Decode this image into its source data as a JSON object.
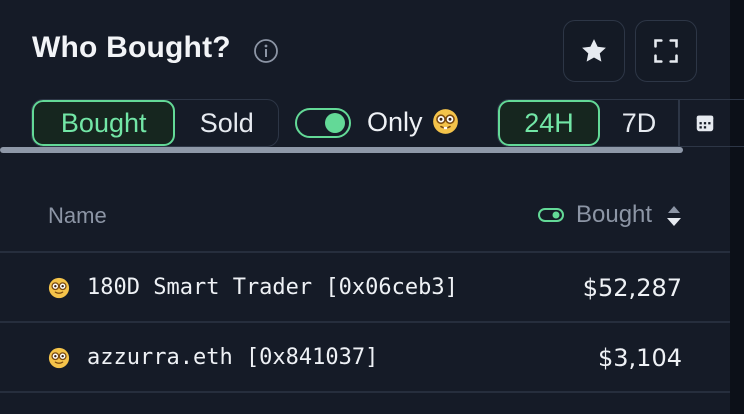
{
  "header": {
    "title": "Who Bought?"
  },
  "filters": {
    "side_options": [
      "Bought",
      "Sold"
    ],
    "active_side": "Bought",
    "only_label": "Only",
    "only_toggle_on": true,
    "time_options": [
      "24H",
      "7D"
    ],
    "active_time": "24H"
  },
  "table": {
    "columns": {
      "name": "Name",
      "bought": "Bought"
    },
    "rows": [
      {
        "name": "180D Smart Trader [0x06ceb3]",
        "amount": "$52,287"
      },
      {
        "name": "azzurra.eth [0x841037]",
        "amount": "$3,104"
      }
    ]
  },
  "icons": {
    "info": "info-icon",
    "star": "star-icon",
    "expand": "expand-icon",
    "calendar": "calendar-icon",
    "nerd": "nerd-face-emoji",
    "sort": "sort-icon"
  },
  "colors": {
    "background": "#151b27",
    "accent": "#63d997",
    "muted": "#8c95a5"
  }
}
